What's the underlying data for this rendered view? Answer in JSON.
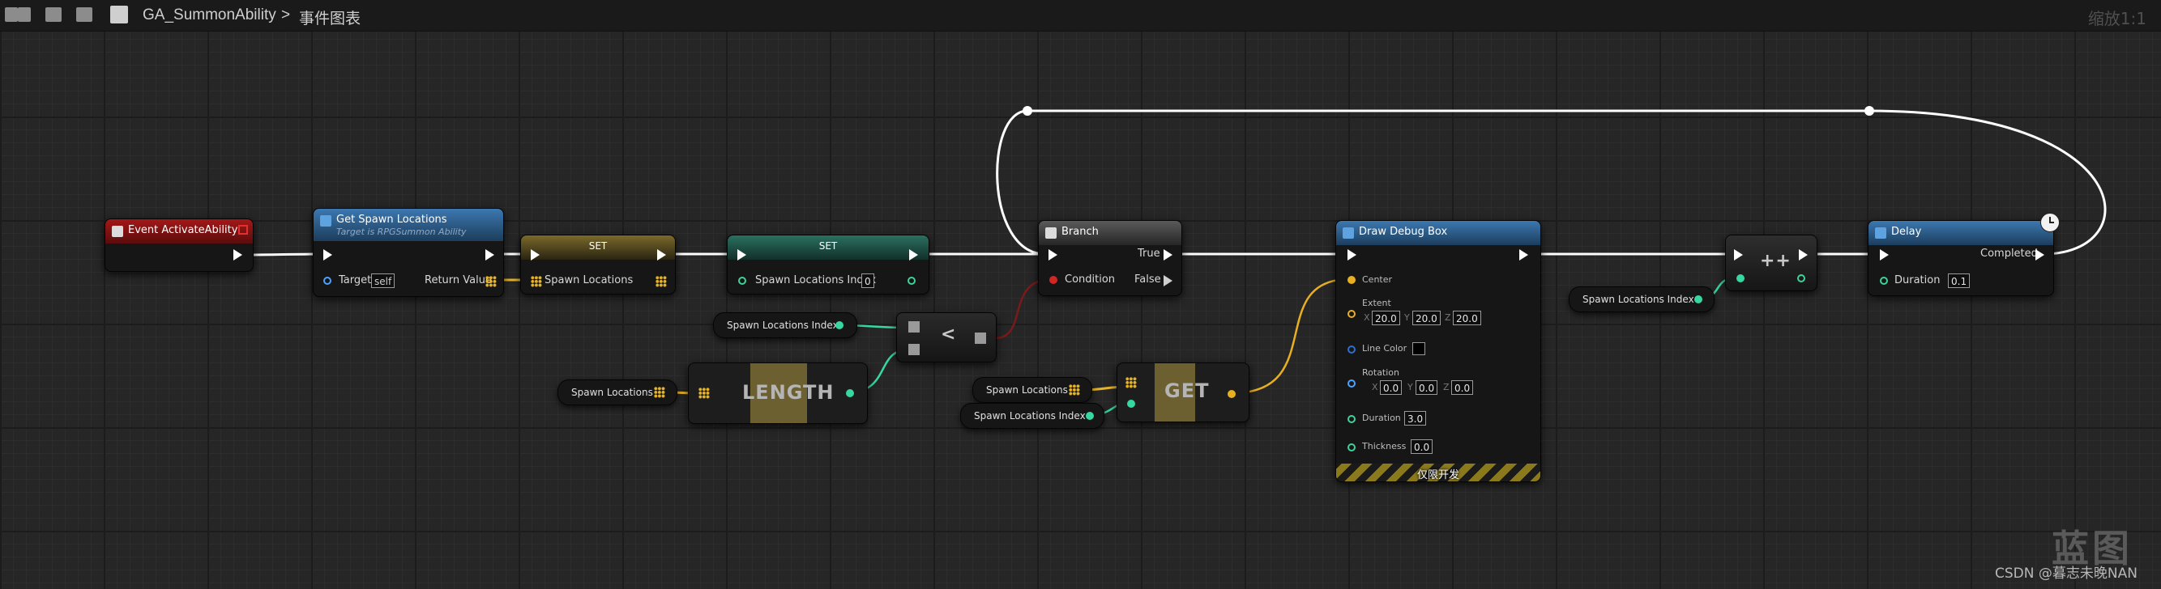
{
  "toolbar": {
    "breadcrumb_asset": "GA_SummonAbility",
    "breadcrumb_separator": ">",
    "breadcrumb_graph": "事件图表",
    "zoom_label": "缩放1:1"
  },
  "nodes": {
    "event_activate": {
      "title": "Event ActivateAbility",
      "header_color": "#8d1414"
    },
    "get_spawn": {
      "title": "Get Spawn Locations",
      "subtitle": "Target is RPGSummon Ability",
      "target_label": "Target",
      "target_value": "self",
      "return_label": "Return Value",
      "header_color": "#2c5b86"
    },
    "set_locations": {
      "title": "SET",
      "pin_label": "Spawn Locations"
    },
    "set_index": {
      "title": "SET",
      "pin_label": "Spawn Locations Index",
      "pin_value": "0"
    },
    "less_than": {
      "symbol": "<"
    },
    "length": {
      "title": "LENGTH"
    },
    "get": {
      "title": "GET"
    },
    "branch": {
      "title": "Branch",
      "true_label": "True",
      "condition_label": "Condition",
      "false_label": "False"
    },
    "draw_debug_box": {
      "title": "Draw Debug Box",
      "center_label": "Center",
      "extent_label": "Extent",
      "extent": {
        "x": "20.0",
        "y": "20.0",
        "z": "20.0"
      },
      "line_color_label": "Line Color",
      "rotation_label": "Rotation",
      "rotation": {
        "x": "0.0",
        "y": "0.0",
        "z": "0.0"
      },
      "duration_label": "Duration",
      "duration_value": "3.0",
      "thickness_label": "Thickness",
      "thickness_value": "0.0",
      "dev_only_label": "仅限开发"
    },
    "increment": {
      "symbol": "++"
    },
    "delay": {
      "title": "Delay",
      "completed_label": "Completed",
      "duration_label": "Duration",
      "duration_value": "0.1"
    }
  },
  "getters": {
    "index_to_less": "Spawn Locations Index",
    "locations_to_length": "Spawn Locations",
    "locations_to_get": "Spawn Locations",
    "index_to_get": "Spawn Locations Index",
    "index_to_increment": "Spawn Locations Index"
  },
  "axis_labels": {
    "x": "X",
    "y": "Y",
    "z": "Z"
  },
  "watermark": {
    "big": "蓝图",
    "small": "CSDN @暮志未晚NAN"
  },
  "colors": {
    "exec_wire": "#ffffff",
    "array_wire": "#e6b42a",
    "int_wire": "#37d7a0",
    "vector_wire": "#e8b020",
    "bool_wire": "#7a1b1b",
    "set_locations_header": "#6b5a22",
    "set_index_header": "#1f5a4c",
    "function_header": "#2c5b86",
    "event_header": "#8d1414",
    "branch_header": "#3a3a3a"
  }
}
